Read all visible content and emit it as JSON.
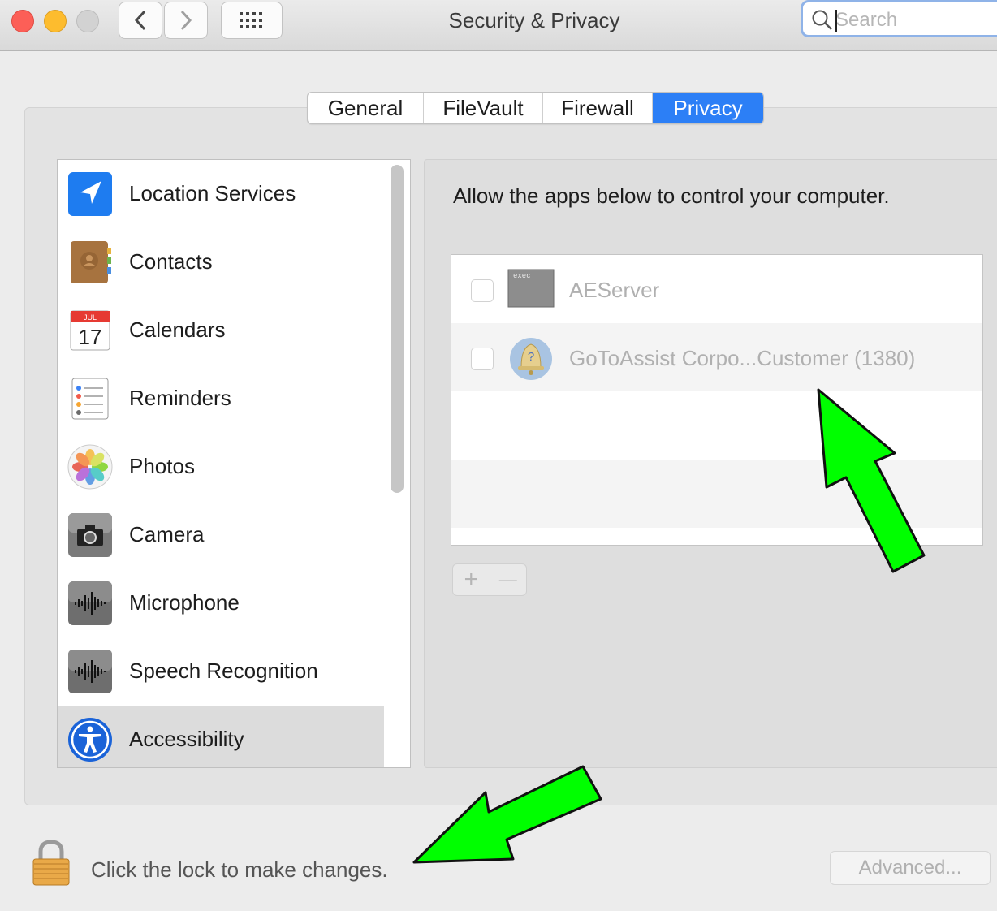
{
  "window": {
    "title": "Security & Privacy"
  },
  "search": {
    "placeholder": "Search"
  },
  "tabs": [
    {
      "label": "General",
      "selected": false
    },
    {
      "label": "FileVault",
      "selected": false
    },
    {
      "label": "Firewall",
      "selected": false
    },
    {
      "label": "Privacy",
      "selected": true
    }
  ],
  "sidebar": {
    "items": [
      {
        "label": "Location Services",
        "icon": "location-arrow-icon"
      },
      {
        "label": "Contacts",
        "icon": "contacts-book-icon"
      },
      {
        "label": "Calendars",
        "icon": "calendar-icon",
        "icon_month": "JUL",
        "icon_day": "17"
      },
      {
        "label": "Reminders",
        "icon": "reminders-list-icon"
      },
      {
        "label": "Photos",
        "icon": "photos-flower-icon"
      },
      {
        "label": "Camera",
        "icon": "camera-icon"
      },
      {
        "label": "Microphone",
        "icon": "waveform-icon"
      },
      {
        "label": "Speech Recognition",
        "icon": "waveform-icon"
      },
      {
        "label": "Accessibility",
        "icon": "accessibility-figure-icon",
        "selected": true
      }
    ]
  },
  "main": {
    "description": "Allow the apps below to control your computer.",
    "apps": [
      {
        "name": "AEServer",
        "icon": "exec-terminal-icon",
        "icon_text": "exec",
        "checked": false
      },
      {
        "name": "GoToAssist Corpo...Customer (1380)",
        "icon": "bell-question-icon",
        "icon_text": "?",
        "checked": false
      }
    ],
    "add_label": "+",
    "remove_label": "—"
  },
  "footer": {
    "lock_text": "Click the lock to make changes.",
    "advanced_label": "Advanced..."
  },
  "colors": {
    "accent": "#2c7ff6",
    "annotation_arrow": "#00ff00"
  }
}
